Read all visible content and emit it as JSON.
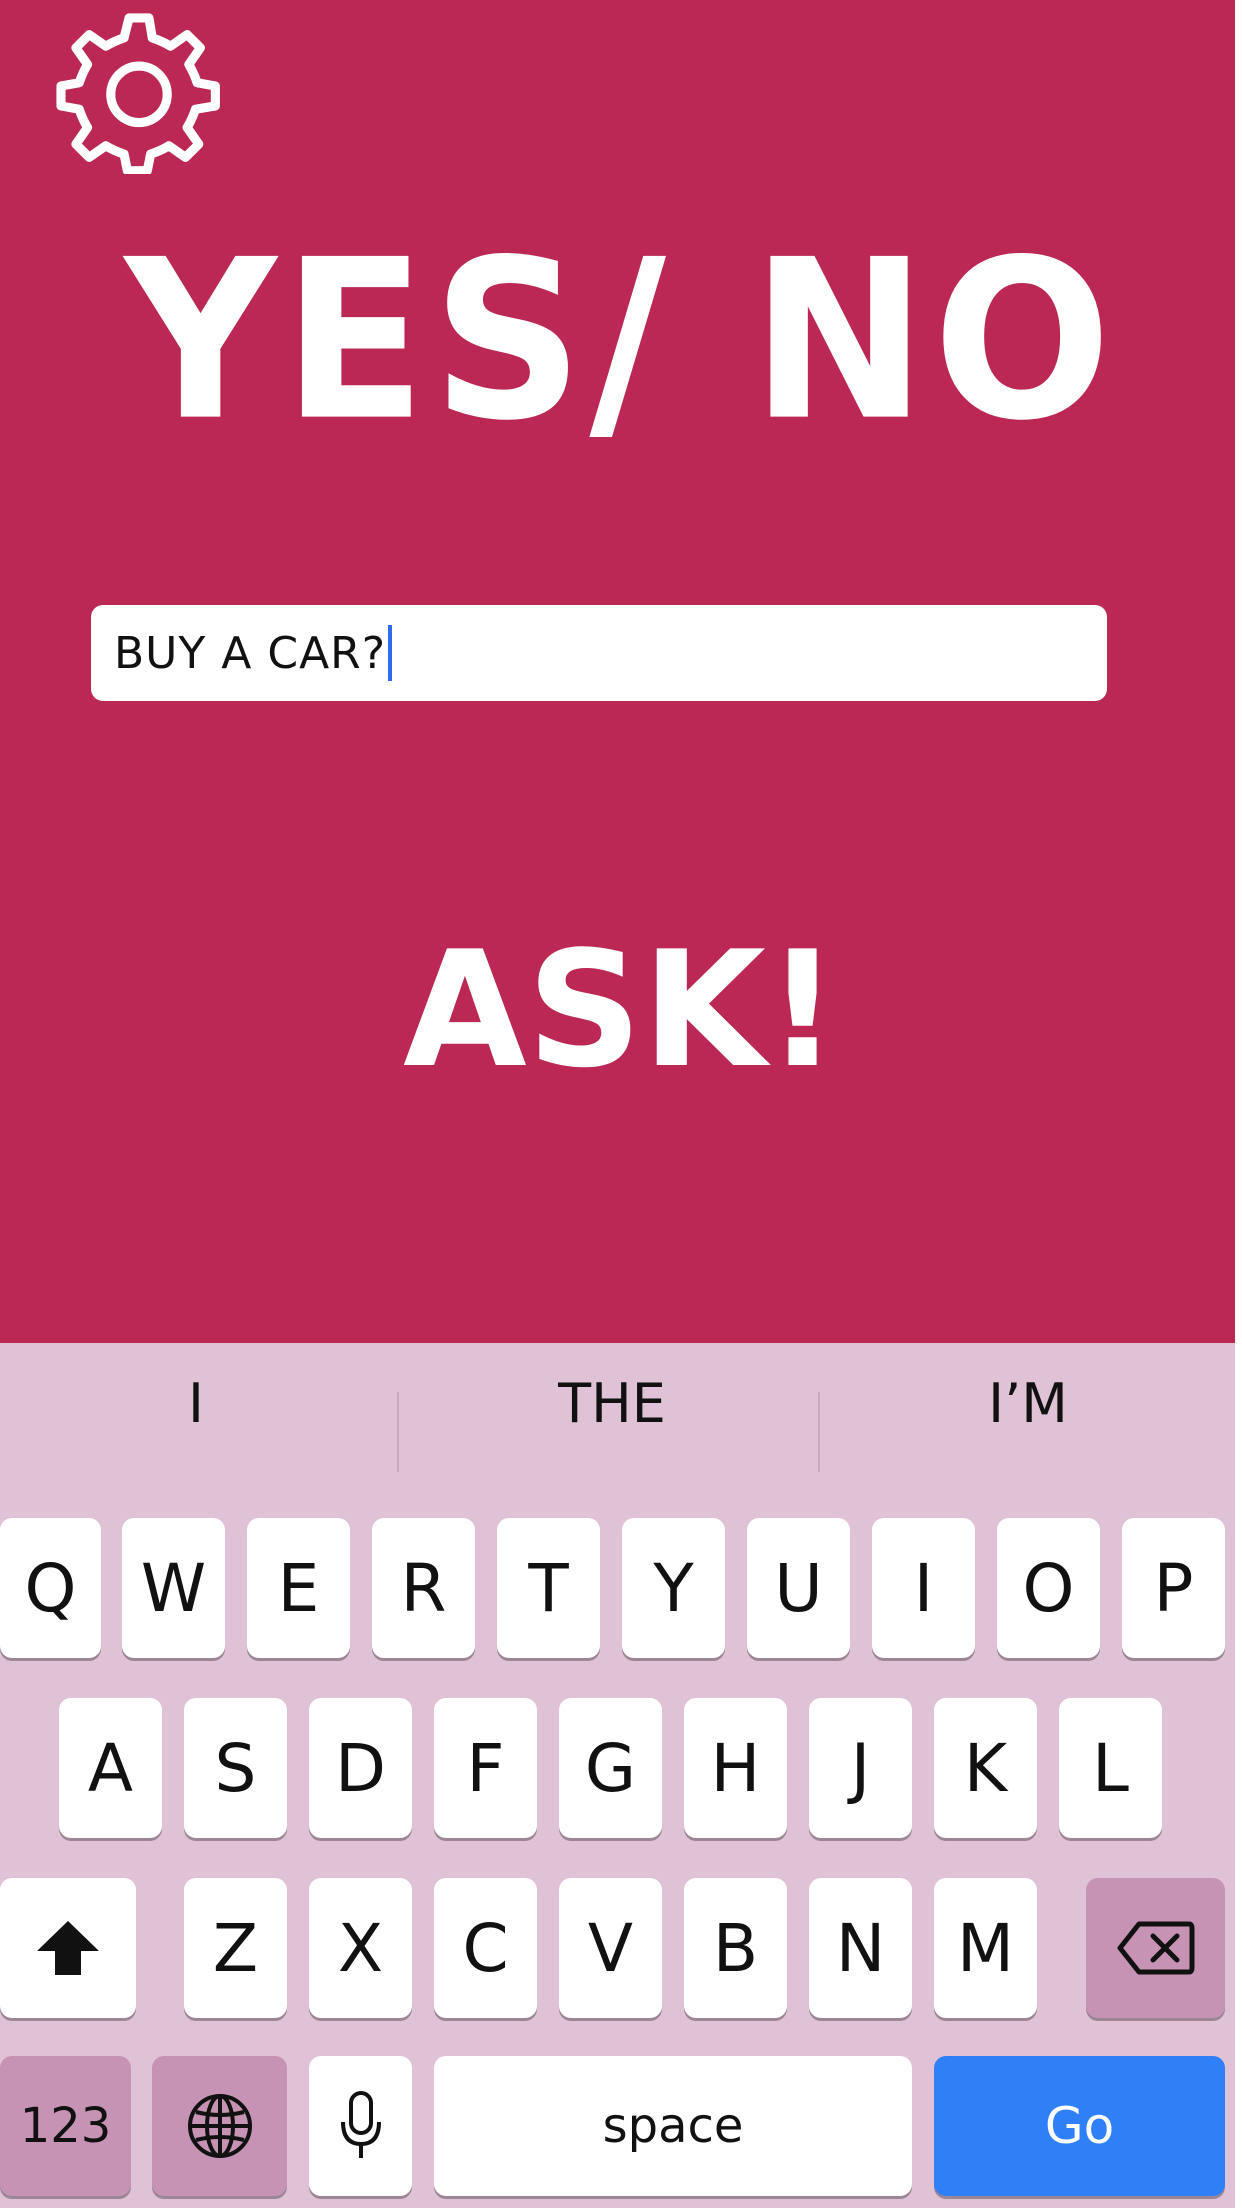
{
  "app": {
    "title": "YES/ NO",
    "question_value": "BUY A CAR?",
    "ask_label": "ASK!",
    "settings_icon": "gear-icon"
  },
  "keyboard": {
    "suggestions": [
      "I",
      "THE",
      "I’M"
    ],
    "row1": [
      "Q",
      "W",
      "E",
      "R",
      "T",
      "Y",
      "U",
      "I",
      "O",
      "P"
    ],
    "row2": [
      "A",
      "S",
      "D",
      "F",
      "G",
      "H",
      "J",
      "K",
      "L"
    ],
    "row3": [
      "Z",
      "X",
      "C",
      "V",
      "B",
      "N",
      "M"
    ],
    "numbers_label": "123",
    "space_label": "space",
    "go_label": "Go",
    "icons": [
      "shift-icon",
      "backspace-icon",
      "globe-icon",
      "microphone-icon"
    ]
  },
  "colors": {
    "background": "#bb2853",
    "keyboard_bg": "#dfc2d6",
    "go_button": "#2f7ff7",
    "caret": "#2f6cf4"
  }
}
